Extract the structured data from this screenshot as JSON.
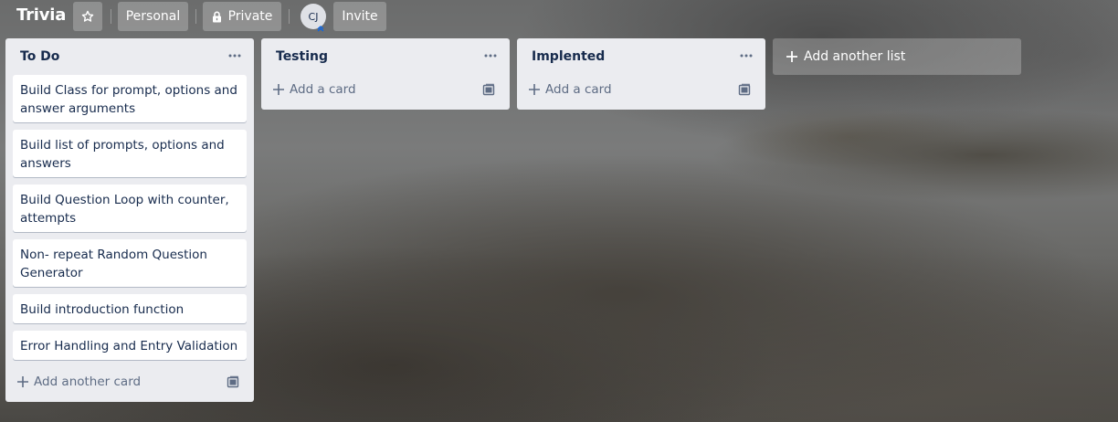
{
  "board": {
    "title": "Trivia",
    "personal_label": "Personal",
    "visibility_label": "Private",
    "member_initials": "CJ",
    "invite_label": "Invite"
  },
  "lists": [
    {
      "title": "To Do",
      "cards": [
        "Build Class for prompt, options and answer arguments",
        "Build list of prompts, options and answers",
        "Build Question Loop with counter, attempts",
        "Non- repeat Random Question Generator",
        "Build introduction function",
        "Error Handling and Entry Validation"
      ],
      "composer_label": "Add another card"
    },
    {
      "title": "Testing",
      "cards": [],
      "composer_label": "Add a card"
    },
    {
      "title": "Implented",
      "cards": [],
      "composer_label": "Add a card"
    }
  ],
  "add_list_label": "Add another list",
  "icons": {
    "star": "star-icon",
    "lock": "lock-icon",
    "list_menu": "more-horizontal-icon",
    "add": "plus-icon",
    "template": "card-template-icon",
    "admin_badge": "admin-chevron-icon"
  },
  "colors": {
    "list_background": "#ebecf0",
    "card_background": "#ffffff",
    "text": "#172b4d",
    "muted_text": "#5e6c84",
    "header_button": "rgba(255,255,255,0.24)"
  }
}
